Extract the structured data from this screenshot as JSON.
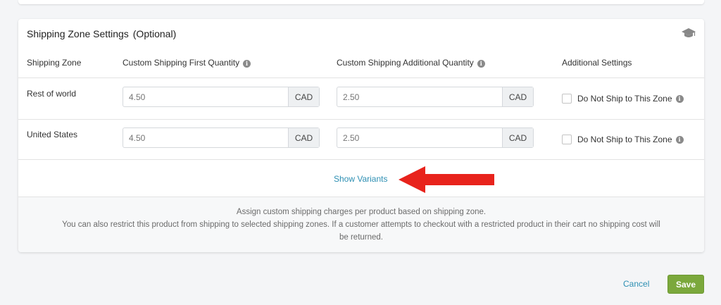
{
  "section": {
    "title": "Shipping Zone Settings",
    "optional_label": "(Optional)",
    "icon": "graduation-cap-icon"
  },
  "table": {
    "headers": {
      "zone": "Shipping Zone",
      "first_qty": "Custom Shipping First Quantity",
      "additional_qty": "Custom Shipping Additional Quantity",
      "additional_settings": "Additional Settings"
    },
    "rows": [
      {
        "zone": "Rest of world",
        "first_placeholder": "4.50",
        "first_currency": "CAD",
        "additional_placeholder": "2.50",
        "additional_currency": "CAD",
        "checkbox_label": "Do Not Ship to This Zone",
        "checked": false
      },
      {
        "zone": "United States",
        "first_placeholder": "4.50",
        "first_currency": "CAD",
        "additional_placeholder": "2.50",
        "additional_currency": "CAD",
        "checkbox_label": "Do Not Ship to This Zone",
        "checked": false
      }
    ]
  },
  "show_variants_label": "Show Variants",
  "footer": {
    "line1": "Assign custom shipping charges per product based on shipping zone.",
    "line2": "You can also restrict this product from shipping to selected shipping zones. If a customer attempts to checkout with a restricted product in their cart no shipping cost will",
    "line3": "be returned."
  },
  "actions": {
    "cancel_label": "Cancel",
    "save_label": "Save"
  },
  "colors": {
    "link": "#2d8fb3",
    "save_button": "#7ba83c",
    "annotation_arrow": "#e8231c"
  }
}
